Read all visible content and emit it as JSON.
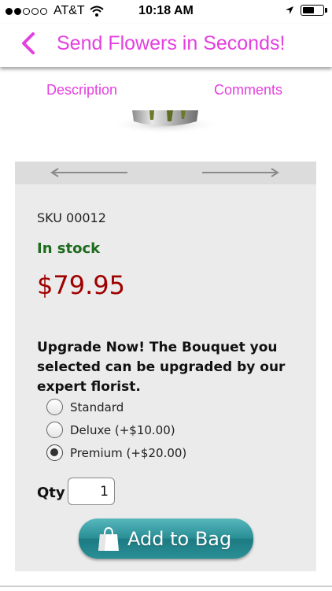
{
  "status_bar": {
    "carrier": "AT&T",
    "time": "10:18 AM",
    "signal_filled": 2,
    "signal_total": 5
  },
  "nav": {
    "title": "Send Flowers in Seconds!",
    "back_icon": "chevron-left-icon",
    "accent_color": "#e43fe0"
  },
  "tabs": [
    {
      "label": "Description"
    },
    {
      "label": "Comments"
    }
  ],
  "product": {
    "sku": "SKU 00012",
    "stock_status": "In stock",
    "price": "$79.95",
    "upgrade_text": "Upgrade Now! The Bouquet you selected can be upgraded by our expert florist.",
    "options": [
      {
        "label": "Standard",
        "selected": false
      },
      {
        "label": "Deluxe (+$10.00)",
        "selected": false
      },
      {
        "label": "Premium (+$20.00)",
        "selected": true
      }
    ],
    "qty_label": "Qty",
    "qty_value": "1",
    "add_button_label": "Add to Bag"
  },
  "colors": {
    "stock": "#1e6b1e",
    "price": "#a00000",
    "button": "#2a8f96"
  }
}
